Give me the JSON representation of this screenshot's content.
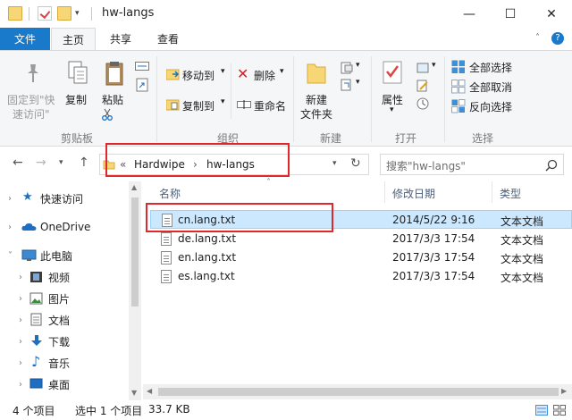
{
  "window": {
    "title": "hw-langs",
    "minimize": "—",
    "maximize": "☐",
    "close": "✕"
  },
  "ribbon_tabs": [
    "文件",
    "主页",
    "共享",
    "查看"
  ],
  "ribbon": {
    "pin_label_1": "固定到\"快",
    "pin_label_2": "速访问\"",
    "copy": "复制",
    "paste": "粘贴",
    "group_clipboard": "剪贴板",
    "move_to": "移动到",
    "copy_to": "复制到",
    "delete": "删除",
    "rename": "重命名",
    "group_organize": "组织",
    "new_folder_1": "新建",
    "new_folder_2": "文件夹",
    "group_new": "新建",
    "properties": "属性",
    "group_open": "打开",
    "select_all": "全部选择",
    "select_none": "全部取消",
    "invert_selection": "反向选择",
    "group_select": "选择"
  },
  "address": {
    "prefix": "«",
    "crumbs": [
      "Hardwipe",
      "hw-langs"
    ],
    "separator": "›",
    "search_placeholder": "搜索\"hw-langs\""
  },
  "nav_pane": {
    "items": [
      {
        "label": "快速访问",
        "icon": "star-icon",
        "level": 0
      },
      {
        "label": "OneDrive",
        "icon": "cloud-icon",
        "level": 0
      },
      {
        "label": "此电脑",
        "icon": "computer-icon",
        "level": 0
      },
      {
        "label": "视频",
        "icon": "video-icon",
        "level": 1
      },
      {
        "label": "图片",
        "icon": "pictures-icon",
        "level": 1
      },
      {
        "label": "文档",
        "icon": "documents-icon",
        "level": 1
      },
      {
        "label": "下载",
        "icon": "download-icon",
        "level": 1
      },
      {
        "label": "音乐",
        "icon": "music-icon",
        "level": 1
      },
      {
        "label": "桌面",
        "icon": "desktop-icon",
        "level": 1
      }
    ]
  },
  "file_list": {
    "columns": [
      "名称",
      "修改日期",
      "类型"
    ],
    "rows": [
      {
        "name": "cn.lang.txt",
        "date": "2014/5/22 9:16",
        "type": "文本文档",
        "selected": true
      },
      {
        "name": "de.lang.txt",
        "date": "2017/3/3 17:54",
        "type": "文本文档",
        "selected": false
      },
      {
        "name": "en.lang.txt",
        "date": "2017/3/3 17:54",
        "type": "文本文档",
        "selected": false
      },
      {
        "name": "es.lang.txt",
        "date": "2017/3/3 17:54",
        "type": "文本文档",
        "selected": false
      }
    ]
  },
  "status": {
    "count": "4 个项目",
    "selected": "选中 1 个项目",
    "size": "33.7 KB"
  },
  "colors": {
    "file_tab": "#1979ca",
    "selection": "#cce8ff",
    "highlight": "#e0272b"
  }
}
